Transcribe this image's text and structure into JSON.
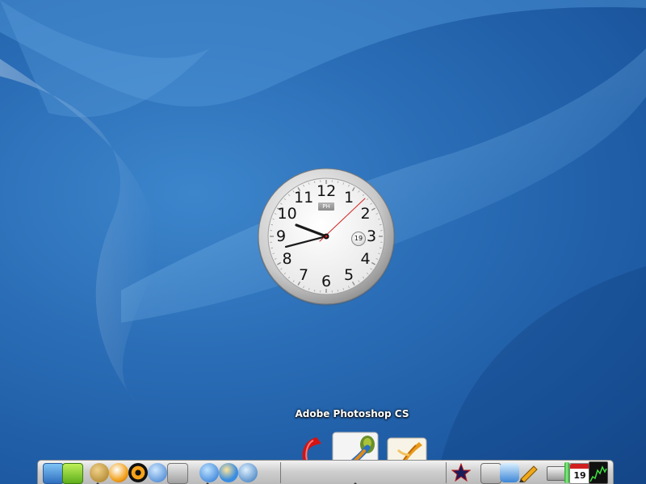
{
  "clock": {
    "brand": "PH",
    "date": "19",
    "numbers": [
      "12",
      "1",
      "2",
      "3",
      "4",
      "5",
      "6",
      "7",
      "8",
      "9",
      "10",
      "11"
    ]
  },
  "dock": {
    "hover_label": "Adobe Photoshop CS",
    "calendar_day": "19",
    "icons": [
      "finder-icon",
      "ichat-icon",
      "sherlock-icon",
      "address-book-icon",
      "burn-icon",
      "radioactive-icon",
      "quicktime-icon",
      "preview-icon",
      "internet-explorer-icon",
      "safari-icon",
      "network-icon",
      "flash-icon",
      "photoshop-cs-icon",
      "illustrator-cs-icon",
      "imovie-star-icon",
      "system-preferences-icon",
      "itunes-icon",
      "pencil-app-icon",
      "hard-drive-icon",
      "battery-icon",
      "ical-icon",
      "activity-monitor-icon"
    ]
  },
  "colors": {
    "wallpaper": "#2a6db6",
    "dock": "#cfcfcf",
    "second_hand": "#d42020"
  }
}
